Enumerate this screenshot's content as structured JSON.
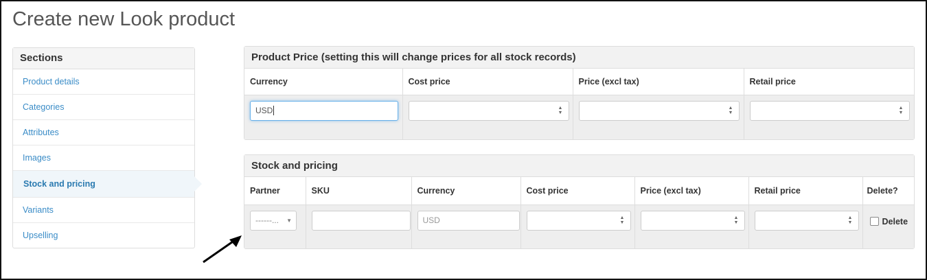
{
  "page": {
    "title": "Create new Look product"
  },
  "sidebar": {
    "heading": "Sections",
    "items": [
      {
        "label": "Product details"
      },
      {
        "label": "Categories"
      },
      {
        "label": "Attributes"
      },
      {
        "label": "Images"
      },
      {
        "label": "Stock and pricing",
        "active": true
      },
      {
        "label": "Variants"
      },
      {
        "label": "Upselling"
      }
    ]
  },
  "product_price": {
    "heading": "Product Price (setting this will change prices for all stock records)",
    "columns": [
      "Currency",
      "Cost price",
      "Price (excl tax)",
      "Retail price"
    ],
    "currency_value": "USD",
    "cost_price": "",
    "price_excl_tax": "",
    "retail_price": ""
  },
  "stock": {
    "heading": "Stock and pricing",
    "columns": [
      "Partner",
      "SKU",
      "Currency",
      "Cost price",
      "Price (excl tax)",
      "Retail price",
      "Delete?"
    ],
    "partner_value": "------...",
    "sku_value": "",
    "currency_placeholder": "USD",
    "delete_label": "Delete"
  },
  "colors": {
    "link": "#3a8cc7",
    "focus": "#66afe9"
  },
  "icons": {
    "spinner": "spinner-arrows-icon",
    "annotation": "arrow-annotation-icon"
  }
}
